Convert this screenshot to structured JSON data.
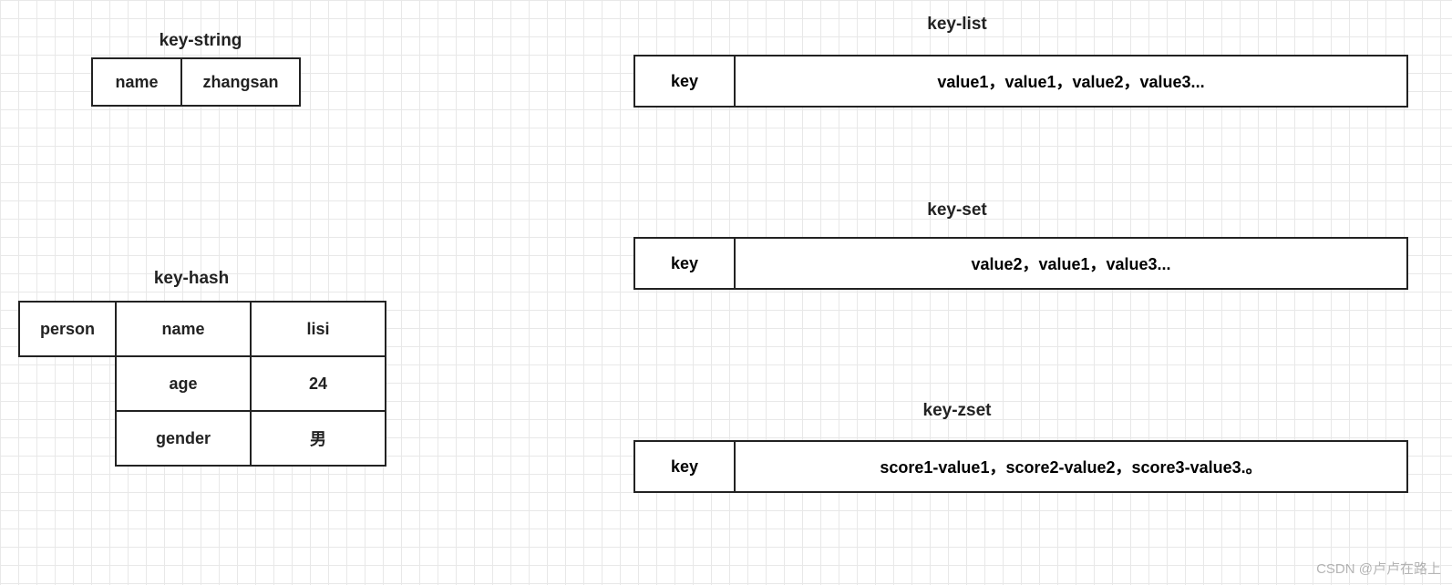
{
  "keyString": {
    "title": "key-string",
    "key": "name",
    "value": "zhangsan"
  },
  "keyHash": {
    "title": "key-hash",
    "key": "person",
    "rows": [
      {
        "field": "name",
        "value": "lisi"
      },
      {
        "field": "age",
        "value": "24"
      },
      {
        "field": "gender",
        "value": "男"
      }
    ]
  },
  "keyList": {
    "title": "key-list",
    "key": "key",
    "value": "value1，value1，value2，value3..."
  },
  "keySet": {
    "title": "key-set",
    "key": "key",
    "value": "value2，value1，value3..."
  },
  "keyZset": {
    "title": "key-zset",
    "key": "key",
    "value": "score1-value1，score2-value2，score3-value3.。"
  },
  "watermark": "CSDN @卢卢在路上"
}
